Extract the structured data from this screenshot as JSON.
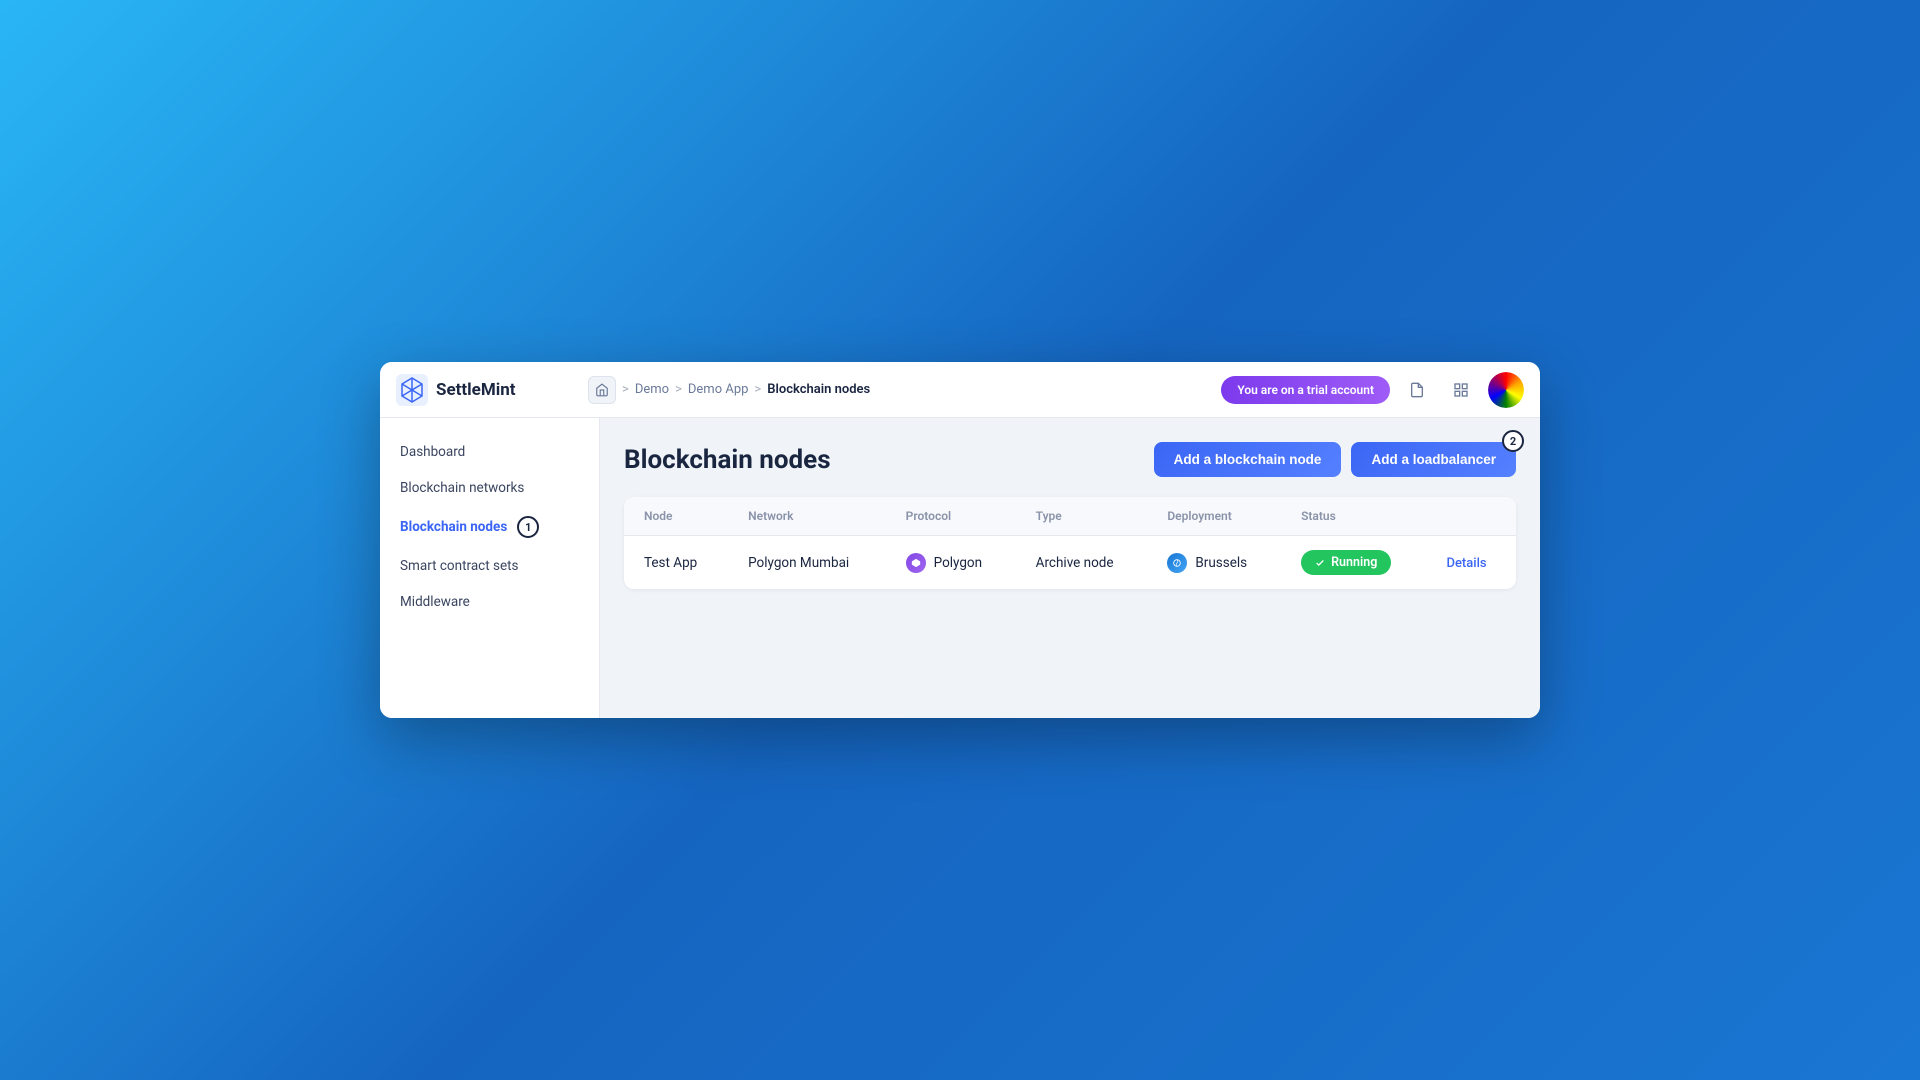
{
  "app": {
    "logo_text": "SettleMint",
    "window_bg": "#f0f4f8"
  },
  "top_bar": {
    "trial_badge": "You are on a trial account",
    "breadcrumb": {
      "home_label": "home",
      "separator": ">",
      "items": [
        "Demo",
        "Demo App",
        "Blockchain nodes"
      ]
    },
    "icons": {
      "document": "📄",
      "grid": "⊞"
    }
  },
  "sidebar": {
    "items": [
      {
        "id": "dashboard",
        "label": "Dashboard",
        "active": false,
        "badge": null
      },
      {
        "id": "blockchain-networks",
        "label": "Blockchain networks",
        "active": false,
        "badge": null
      },
      {
        "id": "blockchain-nodes",
        "label": "Blockchain nodes",
        "active": true,
        "badge": "1"
      },
      {
        "id": "smart-contract-sets",
        "label": "Smart contract sets",
        "active": false,
        "badge": null
      },
      {
        "id": "middleware",
        "label": "Middleware",
        "active": false,
        "badge": null
      }
    ]
  },
  "main": {
    "page_title": "Blockchain nodes",
    "add_node_btn": "Add a blockchain node",
    "add_loadbalancer_btn": "Add a loadbalancer",
    "loadbalancer_step": "2",
    "table": {
      "columns": [
        "Node",
        "Network",
        "Protocol",
        "Type",
        "Deployment",
        "Status",
        ""
      ],
      "rows": [
        {
          "node": "Test App",
          "network": "Polygon Mumbai",
          "protocol_icon": "polygon",
          "protocol": "Polygon",
          "type": "Archive node",
          "deployment_icon": "brussels",
          "deployment": "Brussels",
          "status": "Running",
          "action_link": "Details"
        }
      ]
    }
  }
}
